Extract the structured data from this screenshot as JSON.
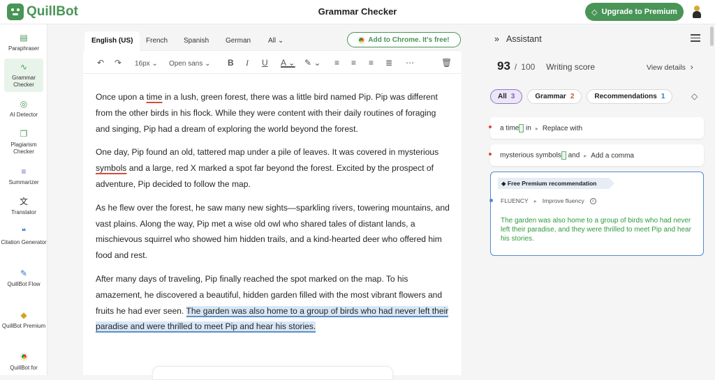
{
  "app": {
    "logo_text": "QuillBot",
    "title": "Grammar Checker",
    "premium_button": "Upgrade to Premium"
  },
  "sidebar": {
    "items": [
      {
        "label": "Paraphraser",
        "icon": "paraphraser-icon"
      },
      {
        "label": "Grammar Checker",
        "icon": "grammar-icon",
        "active": true
      },
      {
        "label": "AI Detector",
        "icon": "ai-detector-icon"
      },
      {
        "label": "Plagiarism Checker",
        "icon": "plagiarism-icon"
      },
      {
        "label": "Summarizer",
        "icon": "summarizer-icon"
      },
      {
        "label": "Translator",
        "icon": "translator-icon"
      },
      {
        "label": "Citation Generator",
        "icon": "citation-icon"
      },
      {
        "label": "QuillBot Flow",
        "icon": "flow-icon"
      },
      {
        "label": "QuillBot Premium",
        "icon": "premium-icon"
      },
      {
        "label": "QuillBot for",
        "icon": "chrome-icon"
      }
    ]
  },
  "editor": {
    "tabs": [
      "English (US)",
      "French",
      "Spanish",
      "German",
      "All"
    ],
    "chrome_button": "Add to Chrome. It's free!",
    "toolbar": {
      "font_size": "16px",
      "font_family": "Open sans"
    },
    "paragraphs": {
      "p1": {
        "a": "Once upon a ",
        "err": "time",
        "b": " in a lush, green forest, there was a little bird named Pip. Pip was different from the other birds in his flock. While they were content with their daily routines of foraging and singing, Pip had a dream of exploring the world beyond the forest."
      },
      "p2": {
        "a": "One day, Pip found an old, tattered map under a pile of leaves. It was covered in mysterious ",
        "err": "symbols",
        "b": " and a large, red X marked a spot far beyond the forest. Excited by the prospect of adventure, Pip decided to follow the map."
      },
      "p3": "As he flew over the forest, he saw many new sights—sparkling rivers, towering mountains, and vast plains. Along the way, Pip met a wise old owl who shared tales of distant lands, a mischievous squirrel who showed him hidden trails, and a kind-hearted deer who offered him food and rest.",
      "p4": {
        "a": "After many days of traveling, Pip finally reached the spot marked on the map. To his amazement, he discovered a beautiful, hidden garden filled with the most vibrant flowers and fruits he had ever seen. ",
        "highlight": "The garden was also home to a group of birds who had never left their paradise and were thrilled to meet Pip and hear his stories."
      }
    }
  },
  "assistant": {
    "title": "Assistant",
    "score": {
      "value": "93",
      "separator": "/",
      "total": "100",
      "label": "Writing score",
      "details": "View details"
    },
    "chips": [
      {
        "label": "All",
        "count": "3"
      },
      {
        "label": "Grammar",
        "count": "2"
      },
      {
        "label": "Recommendations",
        "count": "1"
      }
    ],
    "suggestions": [
      {
        "before": "a time",
        "after": "in",
        "action": "Replace with"
      },
      {
        "before": "mysterious symbols",
        "after": "and",
        "action": "Add a comma"
      }
    ],
    "recommendation": {
      "badge": "Free Premium recommendation",
      "category": "FLUENCY",
      "action": "Improve fluency",
      "text": "The garden was also home to a group of birds who had never left their paradise, and they were thrilled to meet Pip and hear his stories."
    }
  },
  "colors": {
    "brand": "#499557",
    "error": "#d74b3c",
    "highlight": "#d8e6f5",
    "rec_border": "#4f8cd0"
  }
}
